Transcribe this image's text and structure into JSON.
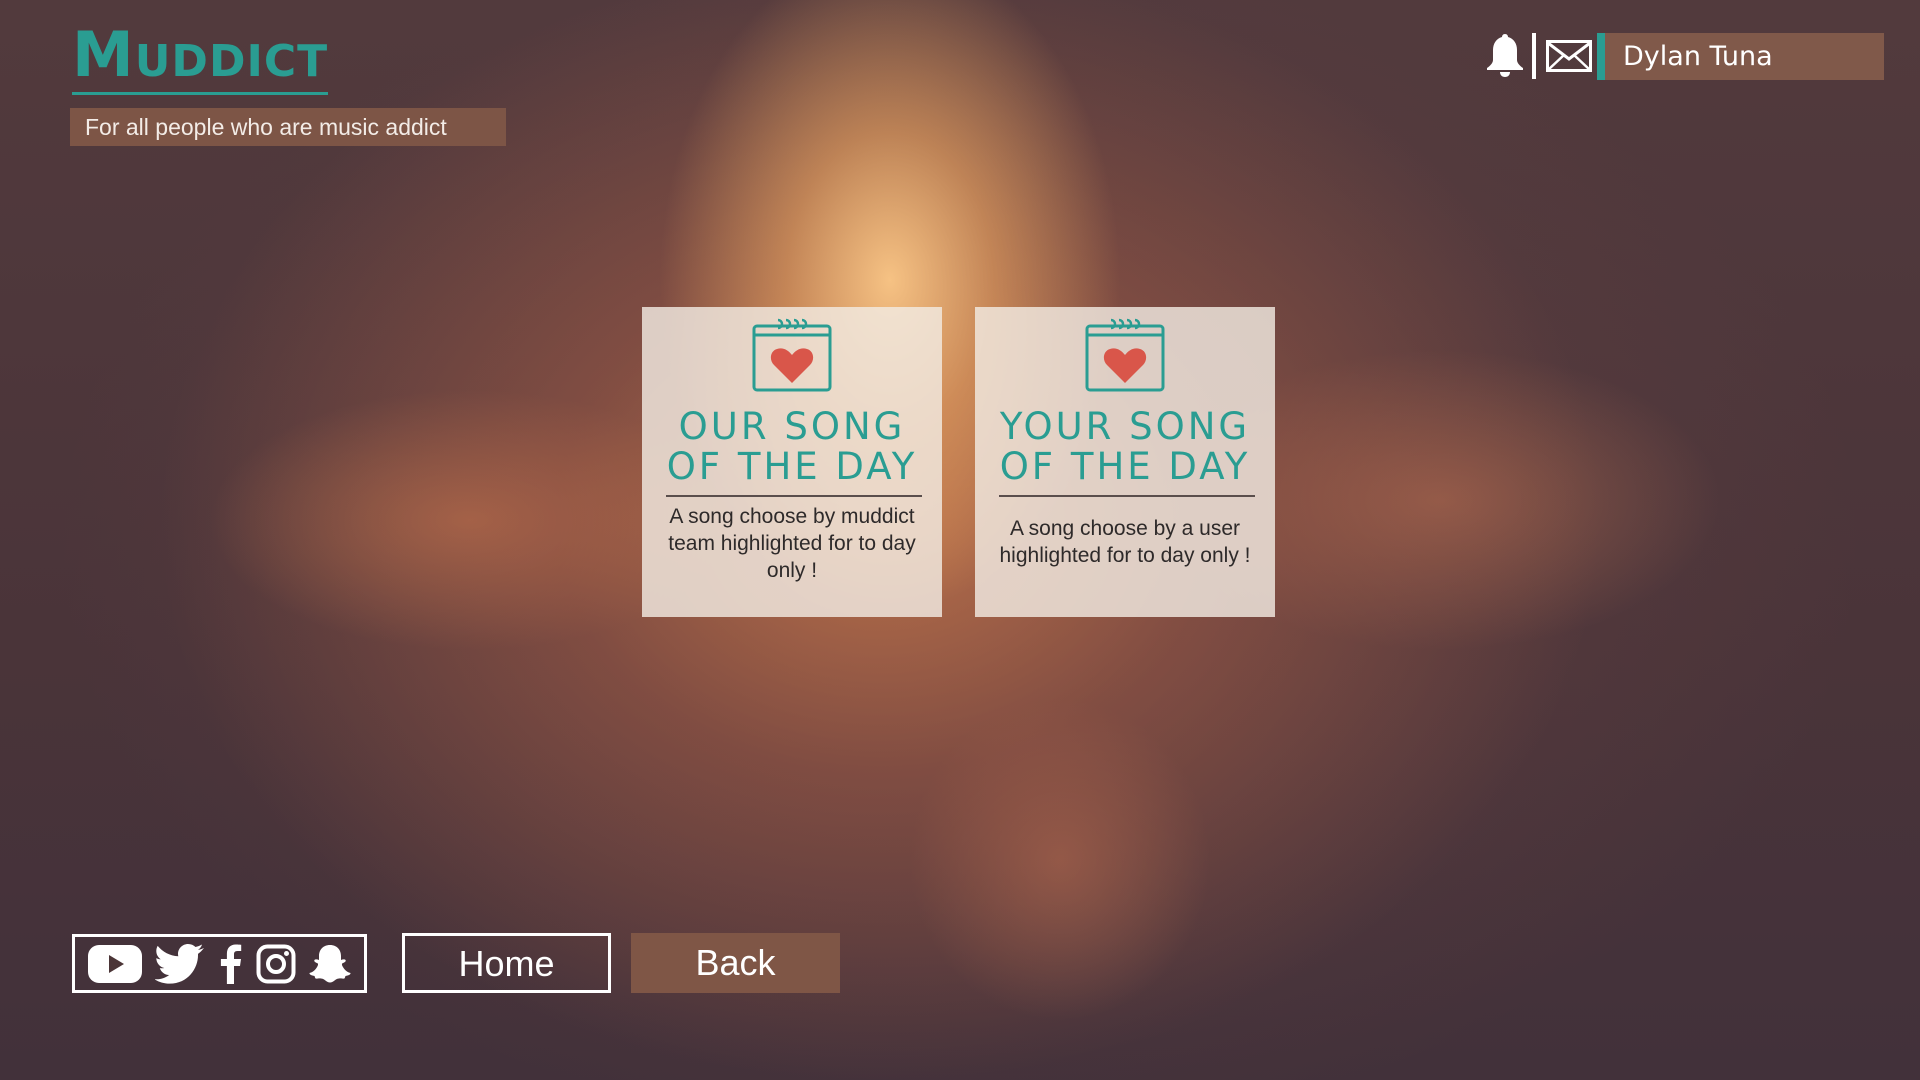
{
  "brand": {
    "logo_initial": "M",
    "logo_rest": "UDDICT",
    "tagline": "For all people who are music addict",
    "accent_color": "#2a9d92",
    "panel_color": "#7f5646"
  },
  "header": {
    "notifications_icon": "bell-icon",
    "messages_icon": "envelope-icon",
    "username": "Dylan Tuna"
  },
  "cards": [
    {
      "icon": "calendar-heart-icon",
      "title_line1": "OUR SONG",
      "title_line2": "OF THE DAY",
      "description": "A song choose by muddict team highlighted for to day only !"
    },
    {
      "icon": "calendar-heart-icon",
      "title_line1": "YOUR SONG",
      "title_line2": "OF THE DAY",
      "description": "A song choose by a user highlighted for to day only !"
    }
  ],
  "social": {
    "icons": [
      "youtube-icon",
      "twitter-icon",
      "facebook-icon",
      "instagram-icon",
      "snapchat-icon"
    ]
  },
  "nav": {
    "home_label": "Home",
    "back_label": "Back"
  }
}
